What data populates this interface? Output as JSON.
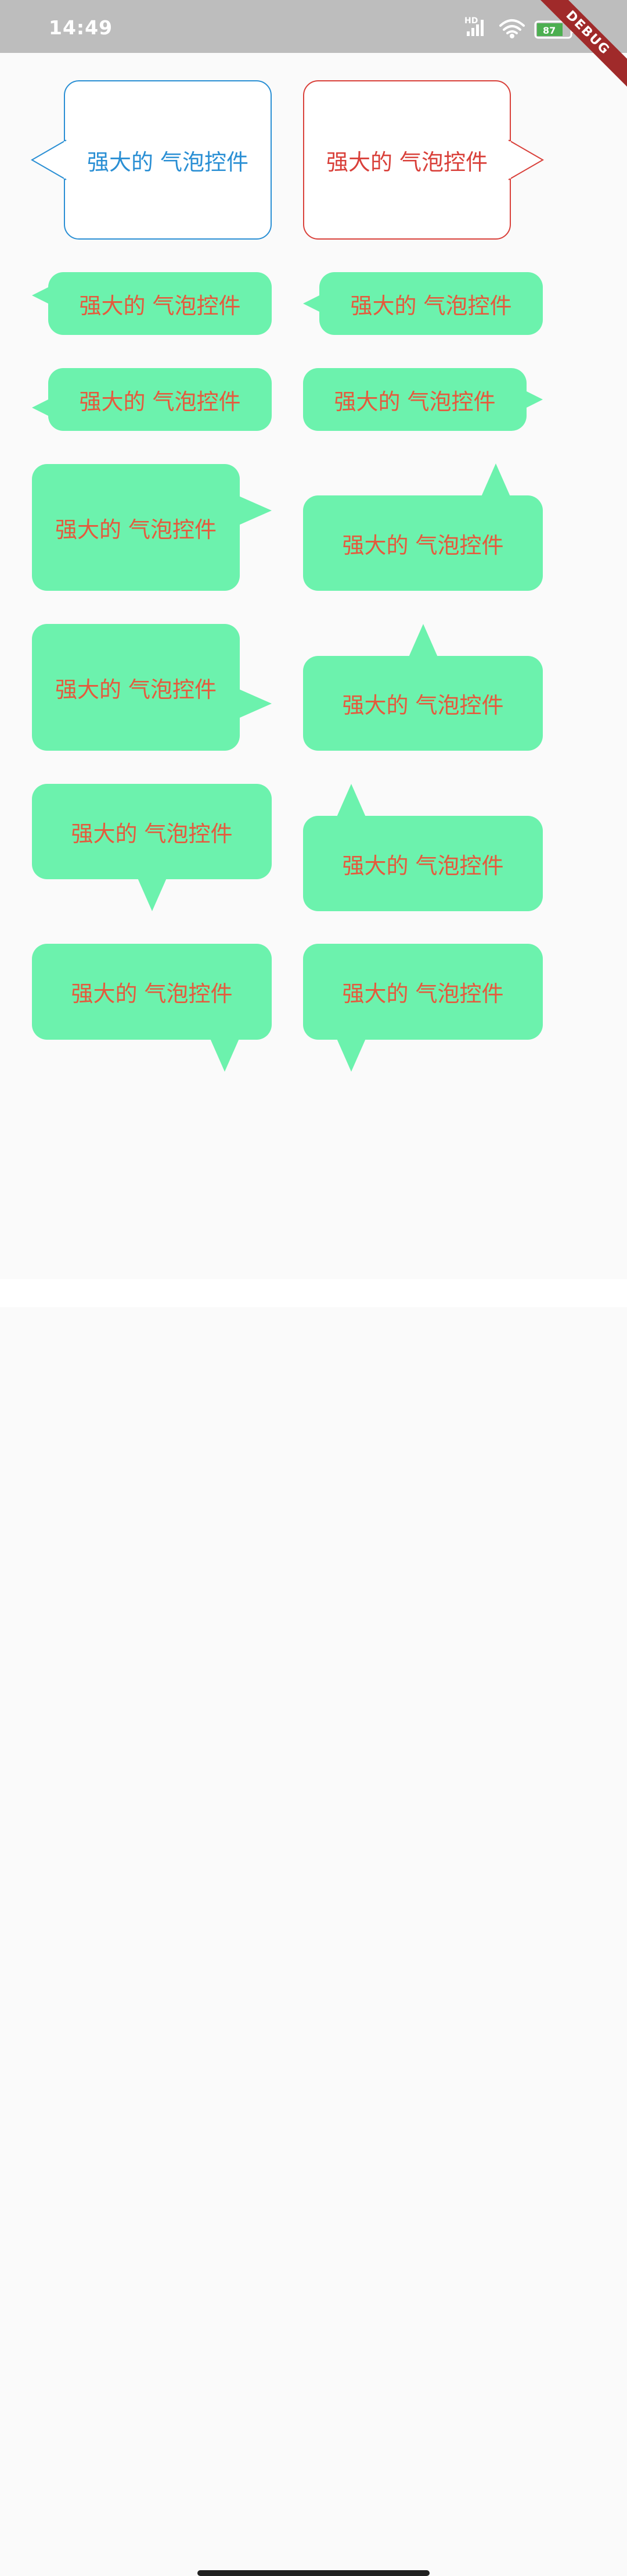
{
  "status_bar": {
    "time": "14:49",
    "network_label": "HD",
    "battery_level": "87",
    "debug_label": "DEBUG",
    "icons": [
      "signal-icon",
      "wifi-icon",
      "battery-icon"
    ]
  },
  "bubbles": [
    {
      "text": "强大的 气泡控件",
      "style": "outline",
      "color": "#2a8fd4",
      "arrow_direction": "left"
    },
    {
      "text": "强大的 气泡控件",
      "style": "outline",
      "color": "#d9403a",
      "arrow_direction": "right"
    },
    {
      "text": "强大的 气泡控件",
      "style": "filled",
      "arrow_direction": "left"
    },
    {
      "text": "强大的 气泡控件",
      "style": "filled",
      "arrow_direction": "left"
    },
    {
      "text": "强大的 气泡控件",
      "style": "filled",
      "arrow_direction": "left"
    },
    {
      "text": "强大的 气泡控件",
      "style": "filled",
      "arrow_direction": "right"
    },
    {
      "text": "强大的 气泡控件",
      "style": "filled",
      "arrow_direction": "right"
    },
    {
      "text": "强大的 气泡控件",
      "style": "filled",
      "arrow_direction": "up"
    },
    {
      "text": "强大的 气泡控件",
      "style": "filled",
      "arrow_direction": "right"
    },
    {
      "text": "强大的 气泡控件",
      "style": "filled",
      "arrow_direction": "up"
    },
    {
      "text": "强大的 气泡控件",
      "style": "filled",
      "arrow_direction": "down"
    },
    {
      "text": "强大的 气泡控件",
      "style": "filled",
      "arrow_direction": "up"
    },
    {
      "text": "强大的 气泡控件",
      "style": "filled",
      "arrow_direction": "down"
    },
    {
      "text": "强大的 气泡控件",
      "style": "filled",
      "arrow_direction": "down"
    }
  ],
  "colors": {
    "bubble_fill": "#6cf2ad",
    "bubble_text": "#e55a3d",
    "status_bar": "#bdbdbd",
    "background": "#fafafa"
  }
}
